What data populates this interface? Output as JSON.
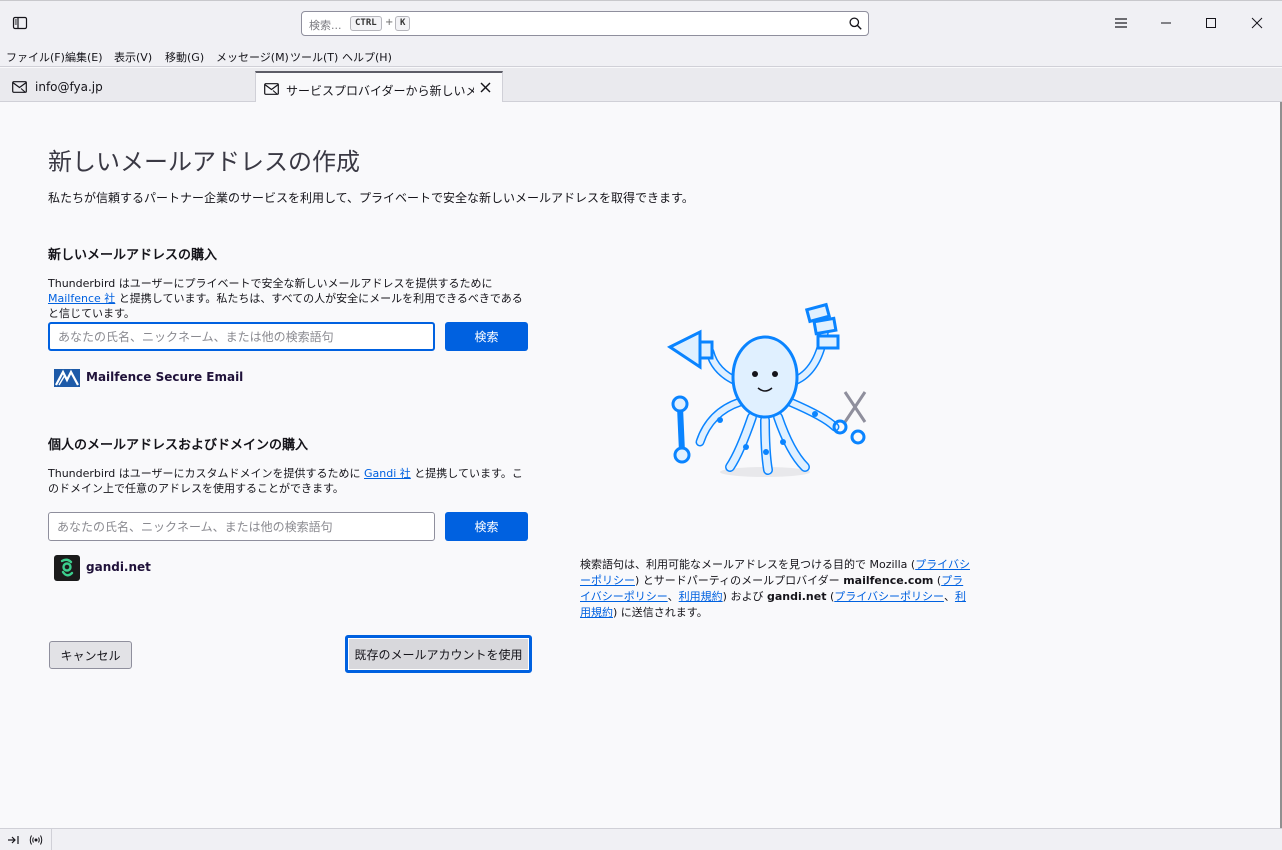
{
  "search": {
    "placeholder": "検索...",
    "shortcut_ctrl": "CTRL",
    "shortcut_plus": "+",
    "shortcut_key": "K"
  },
  "menu": [
    "ファイル(F)",
    "編集(E)",
    "表示(V)",
    "移動(G)",
    "メッセージ(M)",
    "ツール(T)",
    "ヘルプ(H)"
  ],
  "tabs": [
    {
      "label": "info@fya.jp",
      "active": false
    },
    {
      "label": "サービスプロバイダーから新しいメールアドレ",
      "active": true
    }
  ],
  "page": {
    "title": "新しいメールアドレスの作成",
    "description": "私たちが信頼するパートナー企業のサービスを利用して、プライベートで安全な新しいメールアドレスを取得できます。"
  },
  "email_section": {
    "heading": "新しいメールアドレスの購入",
    "text_before": "Thunderbird はユーザーにプライベートで安全な新しいメールアドレスを提供するために ",
    "link": "Mailfence 社",
    "text_after": " と提携しています。私たちは、すべての人が安全にメールを利用できるべきであると信じています。",
    "placeholder": "あなたの氏名、ニックネーム、または他の検索語句",
    "search_button": "検索",
    "provider_name": "Mailfence Secure Email"
  },
  "domain_section": {
    "heading": "個人のメールアドレスおよびドメインの購入",
    "text_before": "Thunderbird はユーザーにカスタムドメインを提供するために ",
    "link": "Gandi 社",
    "text_after": " と提携しています。このドメイン上で任意のアドレスを使用することができます。",
    "placeholder": "あなたの氏名、ニックネーム、または他の検索語句",
    "search_button": "検索",
    "provider_name": "gandi.net"
  },
  "disclaimer": {
    "p1": "検索語句は、利用可能なメールアドレスを見つける目的で Mozilla (",
    "l1": "プライバシーポリシー",
    "p2": ") とサードパーティのメールプロバイダー ",
    "b1": "mailfence.com",
    "p3": " (",
    "l2": "プライバシーポリシー",
    "p4": "、",
    "l3": "利用規約",
    "p5": ") および ",
    "b2": "gandi.net",
    "p6": " (",
    "l4": "プライバシーポリシー",
    "p7": "、",
    "l5": "利用規約",
    "p8": ") に送信されます。"
  },
  "buttons": {
    "cancel": "キャンセル",
    "existing": "既存のメールアカウントを使用"
  },
  "colors": {
    "accent": "#0061e0",
    "octopus_outline": "#0a84ff",
    "octopus_fill": "#e0f0ff"
  }
}
